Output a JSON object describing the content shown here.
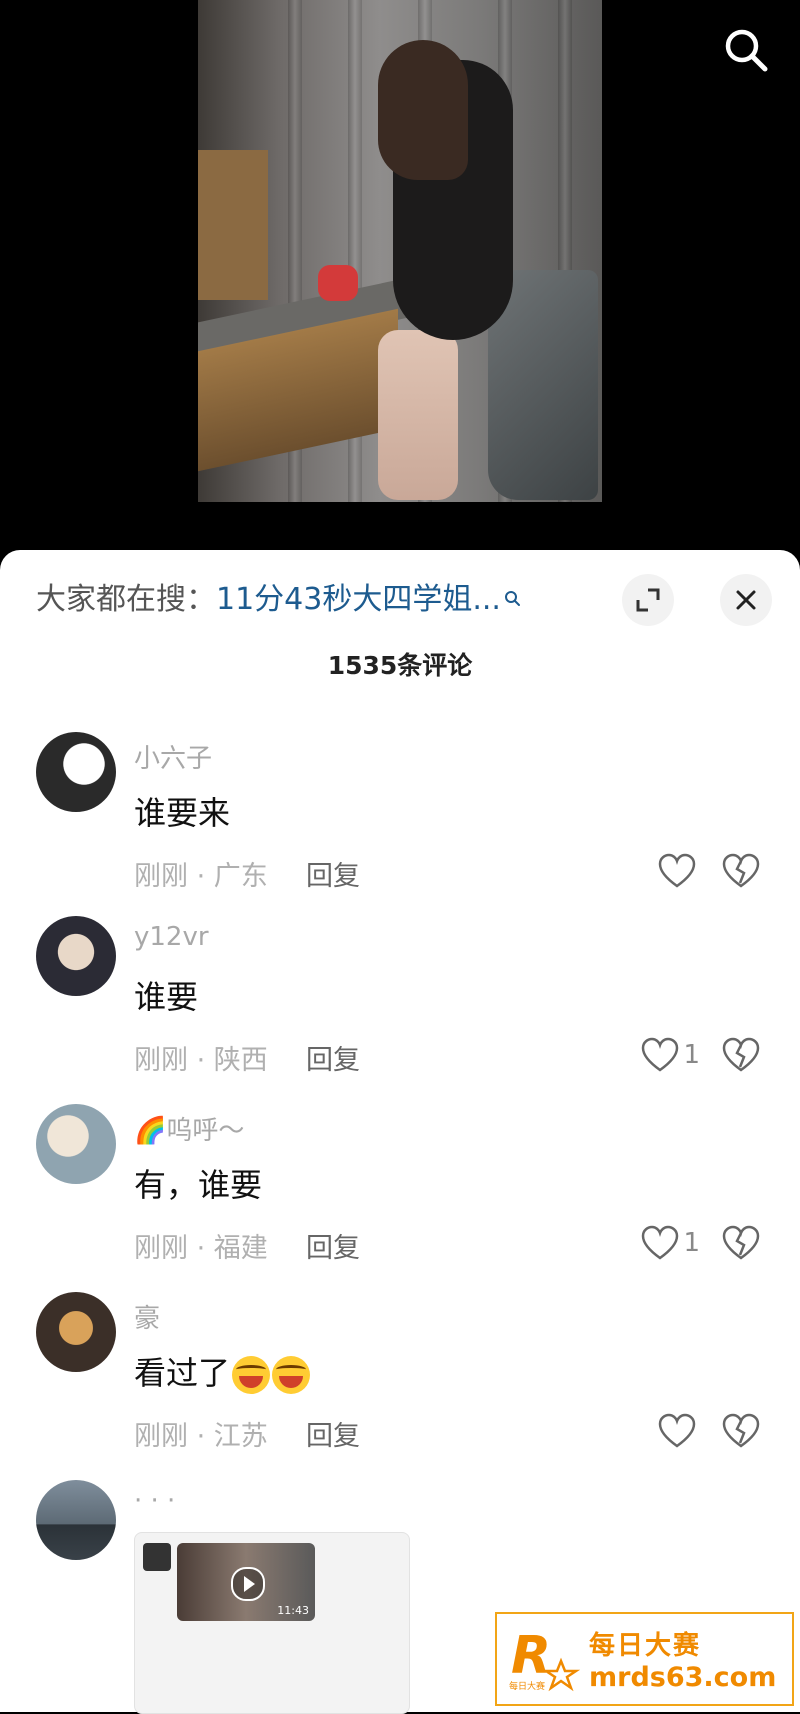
{
  "top_bar": {
    "search_icon": "search-icon"
  },
  "sheet": {
    "search_hint_label": "大家都在搜：",
    "search_query": "11分43秒大四学姐...",
    "expand_icon": "expand-icon",
    "close_icon": "close-icon",
    "comment_count": "1535条评论"
  },
  "comments": [
    {
      "user": "小六子",
      "text": "谁要来",
      "meta": "刚刚 · 广东",
      "reply": "回复",
      "likes": ""
    },
    {
      "user": "y12vr",
      "text": "谁要",
      "meta": "刚刚 · 陕西",
      "reply": "回复",
      "likes": "1"
    },
    {
      "user": "🌈呜呼～",
      "text": "有，谁要",
      "meta": "刚刚 · 福建",
      "reply": "回复",
      "likes": "1"
    },
    {
      "user": "豪",
      "text": "看过了",
      "meta": "刚刚 · 江苏",
      "reply": "回复",
      "likes": ""
    },
    {
      "user": "· · ·",
      "text": "",
      "meta": "",
      "reply": "",
      "likes": ""
    }
  ],
  "media_card": {
    "duration": "11:43"
  },
  "watermark": {
    "title": "每日大赛",
    "url": "mrds63.com",
    "logo_letter": "R",
    "logo_small": "每日大赛"
  },
  "colors": {
    "accent_link": "#1d5b8f",
    "watermark": "#f08a00"
  }
}
